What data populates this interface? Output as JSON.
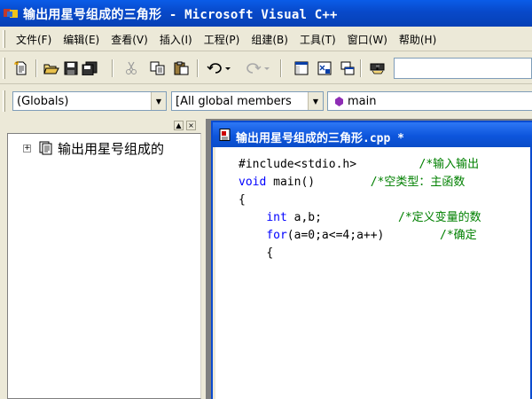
{
  "window": {
    "title": "输出用星号组成的三角形 - Microsoft Visual C++"
  },
  "menu": [
    {
      "label": "文件(F)"
    },
    {
      "label": "编辑(E)"
    },
    {
      "label": "查看(V)"
    },
    {
      "label": "插入(I)"
    },
    {
      "label": "工程(P)"
    },
    {
      "label": "组建(B)"
    },
    {
      "label": "工具(T)"
    },
    {
      "label": "窗口(W)"
    },
    {
      "label": "帮助(H)"
    }
  ],
  "toolbar": {
    "buttons": [
      "new-text-file-icon",
      "open-icon",
      "save-icon",
      "save-all-icon",
      "cut-icon",
      "copy-icon",
      "paste-icon",
      "undo-icon",
      "redo-icon",
      "workspace-icon",
      "output-icon",
      "window-list-icon",
      "find-in-files-icon"
    ],
    "find_value": ""
  },
  "wizardbar": {
    "scope": "(Globals)",
    "members": "[All global members",
    "function": "main"
  },
  "workspace": {
    "tree_root_label": "输出用星号组成的"
  },
  "document": {
    "title": "输出用星号组成的三角形.cpp *",
    "lines": [
      {
        "pre": "#include<stdio.h>",
        "gap": "         ",
        "comment": "/*输入输出"
      },
      {
        "kw": "void",
        "text": " main()",
        "gap": "        ",
        "comment": "/*空类型：主函数"
      },
      {
        "text": "{"
      },
      {
        "indent": "    ",
        "kw": "int",
        "text": " a,b;",
        "gap": "           ",
        "comment": "/*定义变量的数"
      },
      {
        "indent": "    ",
        "kw": "for",
        "text": "(a=0;a<=4;a++)",
        "gap": "        ",
        "comment": "/*确定"
      },
      {
        "indent": "    ",
        "text": "{"
      }
    ]
  },
  "colors": {
    "titlebar": "#0a5ce8",
    "doc_titlebar": "#0d55dc",
    "keyword": "#0000ff",
    "comment": "#008000",
    "function_glyph": "#8e2db5"
  }
}
